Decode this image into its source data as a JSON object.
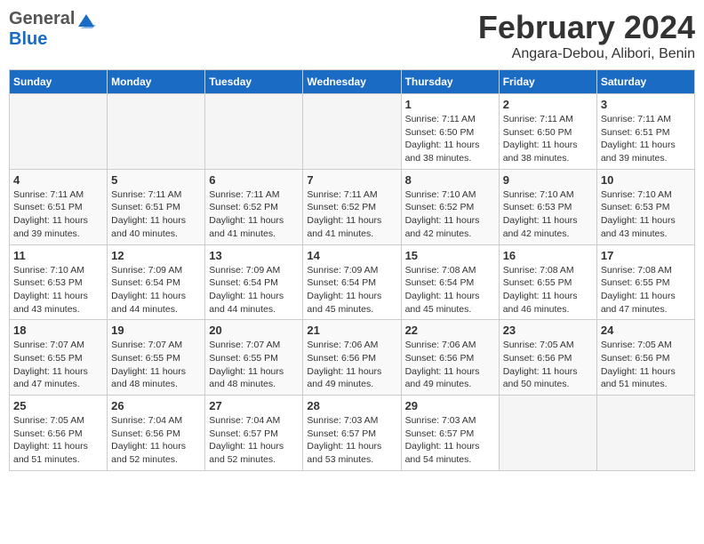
{
  "header": {
    "logo_general": "General",
    "logo_blue": "Blue",
    "month": "February 2024",
    "location": "Angara-Debou, Alibori, Benin"
  },
  "days_of_week": [
    "Sunday",
    "Monday",
    "Tuesday",
    "Wednesday",
    "Thursday",
    "Friday",
    "Saturday"
  ],
  "weeks": [
    [
      {
        "day": "",
        "info": ""
      },
      {
        "day": "",
        "info": ""
      },
      {
        "day": "",
        "info": ""
      },
      {
        "day": "",
        "info": ""
      },
      {
        "day": "1",
        "info": "Sunrise: 7:11 AM\nSunset: 6:50 PM\nDaylight: 11 hours\nand 38 minutes."
      },
      {
        "day": "2",
        "info": "Sunrise: 7:11 AM\nSunset: 6:50 PM\nDaylight: 11 hours\nand 38 minutes."
      },
      {
        "day": "3",
        "info": "Sunrise: 7:11 AM\nSunset: 6:51 PM\nDaylight: 11 hours\nand 39 minutes."
      }
    ],
    [
      {
        "day": "4",
        "info": "Sunrise: 7:11 AM\nSunset: 6:51 PM\nDaylight: 11 hours\nand 39 minutes."
      },
      {
        "day": "5",
        "info": "Sunrise: 7:11 AM\nSunset: 6:51 PM\nDaylight: 11 hours\nand 40 minutes."
      },
      {
        "day": "6",
        "info": "Sunrise: 7:11 AM\nSunset: 6:52 PM\nDaylight: 11 hours\nand 41 minutes."
      },
      {
        "day": "7",
        "info": "Sunrise: 7:11 AM\nSunset: 6:52 PM\nDaylight: 11 hours\nand 41 minutes."
      },
      {
        "day": "8",
        "info": "Sunrise: 7:10 AM\nSunset: 6:52 PM\nDaylight: 11 hours\nand 42 minutes."
      },
      {
        "day": "9",
        "info": "Sunrise: 7:10 AM\nSunset: 6:53 PM\nDaylight: 11 hours\nand 42 minutes."
      },
      {
        "day": "10",
        "info": "Sunrise: 7:10 AM\nSunset: 6:53 PM\nDaylight: 11 hours\nand 43 minutes."
      }
    ],
    [
      {
        "day": "11",
        "info": "Sunrise: 7:10 AM\nSunset: 6:53 PM\nDaylight: 11 hours\nand 43 minutes."
      },
      {
        "day": "12",
        "info": "Sunrise: 7:09 AM\nSunset: 6:54 PM\nDaylight: 11 hours\nand 44 minutes."
      },
      {
        "day": "13",
        "info": "Sunrise: 7:09 AM\nSunset: 6:54 PM\nDaylight: 11 hours\nand 44 minutes."
      },
      {
        "day": "14",
        "info": "Sunrise: 7:09 AM\nSunset: 6:54 PM\nDaylight: 11 hours\nand 45 minutes."
      },
      {
        "day": "15",
        "info": "Sunrise: 7:08 AM\nSunset: 6:54 PM\nDaylight: 11 hours\nand 45 minutes."
      },
      {
        "day": "16",
        "info": "Sunrise: 7:08 AM\nSunset: 6:55 PM\nDaylight: 11 hours\nand 46 minutes."
      },
      {
        "day": "17",
        "info": "Sunrise: 7:08 AM\nSunset: 6:55 PM\nDaylight: 11 hours\nand 47 minutes."
      }
    ],
    [
      {
        "day": "18",
        "info": "Sunrise: 7:07 AM\nSunset: 6:55 PM\nDaylight: 11 hours\nand 47 minutes."
      },
      {
        "day": "19",
        "info": "Sunrise: 7:07 AM\nSunset: 6:55 PM\nDaylight: 11 hours\nand 48 minutes."
      },
      {
        "day": "20",
        "info": "Sunrise: 7:07 AM\nSunset: 6:55 PM\nDaylight: 11 hours\nand 48 minutes."
      },
      {
        "day": "21",
        "info": "Sunrise: 7:06 AM\nSunset: 6:56 PM\nDaylight: 11 hours\nand 49 minutes."
      },
      {
        "day": "22",
        "info": "Sunrise: 7:06 AM\nSunset: 6:56 PM\nDaylight: 11 hours\nand 49 minutes."
      },
      {
        "day": "23",
        "info": "Sunrise: 7:05 AM\nSunset: 6:56 PM\nDaylight: 11 hours\nand 50 minutes."
      },
      {
        "day": "24",
        "info": "Sunrise: 7:05 AM\nSunset: 6:56 PM\nDaylight: 11 hours\nand 51 minutes."
      }
    ],
    [
      {
        "day": "25",
        "info": "Sunrise: 7:05 AM\nSunset: 6:56 PM\nDaylight: 11 hours\nand 51 minutes."
      },
      {
        "day": "26",
        "info": "Sunrise: 7:04 AM\nSunset: 6:56 PM\nDaylight: 11 hours\nand 52 minutes."
      },
      {
        "day": "27",
        "info": "Sunrise: 7:04 AM\nSunset: 6:57 PM\nDaylight: 11 hours\nand 52 minutes."
      },
      {
        "day": "28",
        "info": "Sunrise: 7:03 AM\nSunset: 6:57 PM\nDaylight: 11 hours\nand 53 minutes."
      },
      {
        "day": "29",
        "info": "Sunrise: 7:03 AM\nSunset: 6:57 PM\nDaylight: 11 hours\nand 54 minutes."
      },
      {
        "day": "",
        "info": ""
      },
      {
        "day": "",
        "info": ""
      }
    ]
  ]
}
